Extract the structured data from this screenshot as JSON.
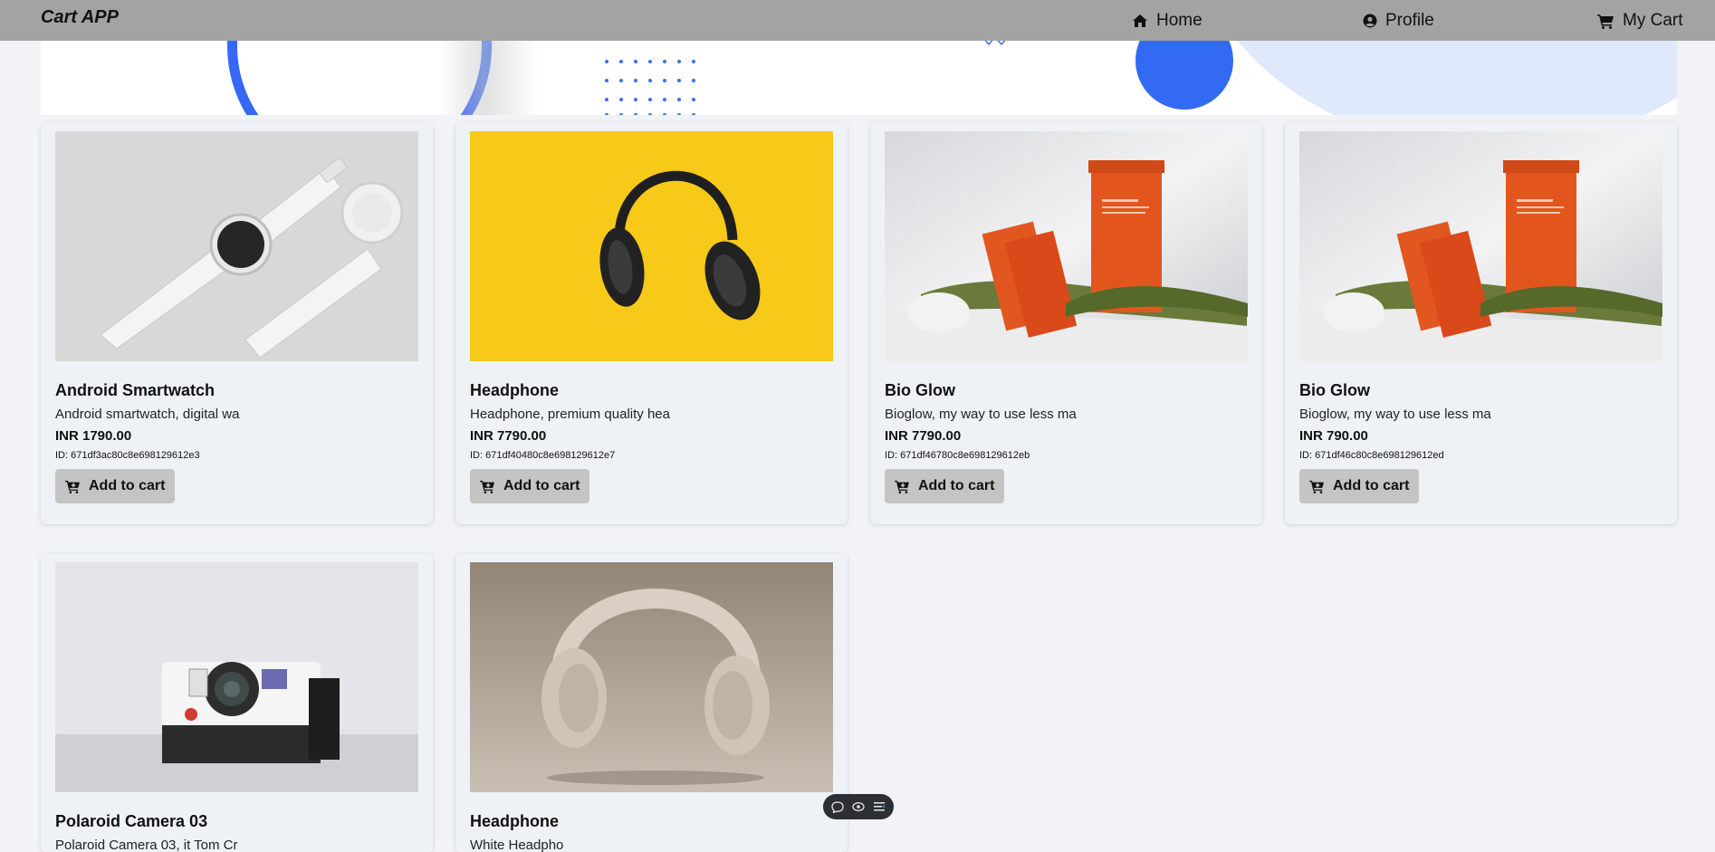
{
  "app": {
    "title": "Cart APP"
  },
  "nav": {
    "home": {
      "label": "Home",
      "icon": "home-icon"
    },
    "profile": {
      "label": "Profile",
      "icon": "user-circle-icon"
    },
    "cart": {
      "label": "My Cart",
      "icon": "shopping-cart-icon"
    }
  },
  "colors": {
    "navbar": "#a3a3a3",
    "accent_blue": "#326af4",
    "card_bg": "#eef2f6",
    "button_bg": "#c4c4c4"
  },
  "products": [
    {
      "name": "Android Smartwatch",
      "description": "Android smartwatch, digital wa",
      "price": "INR 1790.00",
      "id": "ID: 671df3ac80c8e698129612e3",
      "button": "Add to cart",
      "image": "smartwatch-image"
    },
    {
      "name": "Headphone",
      "description": "Headphone, premium quality hea",
      "price": "INR 7790.00",
      "id": "ID: 671df40480c8e698129612e7",
      "button": "Add to cart",
      "image": "headphone-image"
    },
    {
      "name": "Bio Glow",
      "description": "Bioglow, my way to use less ma",
      "price": "INR 7790.00",
      "id": "ID: 671df46780c8e698129612eb",
      "button": "Add to cart",
      "image": "bioglow-image"
    },
    {
      "name": "Bio Glow",
      "description": "Bioglow, my way to use less ma",
      "price": "INR 790.00",
      "id": "ID: 671df46c80c8e698129612ed",
      "button": "Add to cart",
      "image": "bioglow-image"
    },
    {
      "name": "Polaroid Camera 03",
      "description": "Polaroid Camera 03, it Tom Cr",
      "image": "polaroid-camera-image"
    },
    {
      "name": "Headphone",
      "description": "White Headpho",
      "image": "beige-headphone-image"
    }
  ],
  "toolbar": {
    "icons": [
      "comment-icon",
      "eye-icon",
      "list-icon"
    ]
  }
}
